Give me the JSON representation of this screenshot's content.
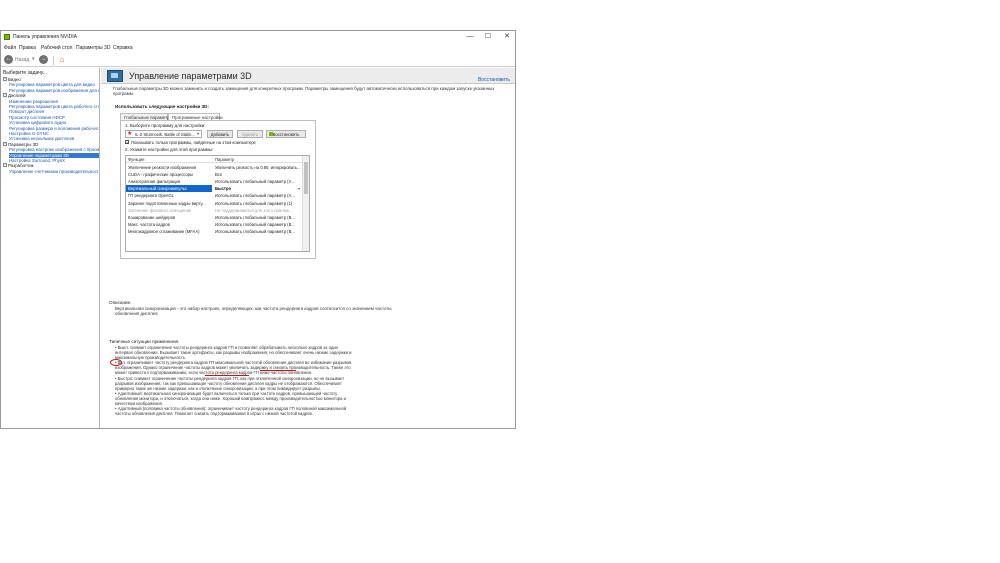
{
  "window": {
    "title": "Панель управления NVIDIA",
    "accent": "#76b900"
  },
  "menu": [
    "Файл",
    "Правка",
    "Рабочий стол",
    "Параметры 3D",
    "Справка"
  ],
  "toolbar": {
    "back_label": "Назад",
    "back_icon": "arrow-left-icon",
    "forward_icon": "arrow-right-icon",
    "home_icon": "home-icon"
  },
  "sidebar": {
    "title": "Выберите задачу...",
    "tree": [
      {
        "label": "Видео",
        "level": 0,
        "toggle": "−"
      },
      {
        "label": "Регулировка параметров цвета для видео",
        "level": 1
      },
      {
        "label": "Регулировка параметров изображения для видео",
        "level": 1
      },
      {
        "label": "Дисплей",
        "level": 0,
        "toggle": "−"
      },
      {
        "label": "Изменение разрешения",
        "level": 1
      },
      {
        "label": "Регулировка параметров цвета рабочего стола",
        "level": 1
      },
      {
        "label": "Поворот дисплея",
        "level": 1
      },
      {
        "label": "Просмотр состояния HDCP",
        "level": 1
      },
      {
        "label": "Установка цифрового аудио",
        "level": 1
      },
      {
        "label": "Регулировка размера и положения рабочего стола",
        "level": 1
      },
      {
        "label": "Настройка G-SYNC",
        "level": 1
      },
      {
        "label": "Установка нескольких дисплеев",
        "level": 1
      },
      {
        "label": "Параметры 3D",
        "level": 0,
        "toggle": "−"
      },
      {
        "label": "Регулировка настроек изображения с просмотром",
        "level": 1
      },
      {
        "label": "Управление параметрами 3D",
        "level": 1,
        "selected": true
      },
      {
        "label": "Настройка Surround, PhysX",
        "level": 1
      },
      {
        "label": "Разработчик",
        "level": 0,
        "toggle": "−"
      },
      {
        "label": "Управление счетчиками производительности",
        "level": 1
      }
    ]
  },
  "banner": {
    "title": "Управление параметрами 3D",
    "restore_link": "Восстановить"
  },
  "intro": "Глобальные параметры 3D можно заменить и создать замещения для конкретных программ. Параметры замещения будут автоматически использоваться при каждом запуске указанных программ.",
  "use_settings_label": "Использовать следующие настройки 3D:",
  "tabs": {
    "global": "Глобальные параметры",
    "program": "Программные настройки"
  },
  "program_settings": {
    "step1": "1. Выберите программу для настройки:",
    "selected_program": "IL-2 Sturmovik: Battle of Stalin...",
    "add_button": "Добавить",
    "delete_button": "Удалить",
    "restore_button": "Восстановить",
    "show_only_label": "Показывать только программы, найденные на этом компьютере",
    "step2": "2. Укажите настройки для этой программы:"
  },
  "settings_table": {
    "headers": [
      "Функция",
      "Параметр"
    ],
    "rows": [
      {
        "feature": "Увеличение резкости изображения",
        "value": "Увеличить резкость на 0.80, игнорировать..."
      },
      {
        "feature": "CUDA - графические процессоры",
        "value": "Все"
      },
      {
        "feature": "Анизотропная фильтрация",
        "value": "Использовать глобальный параметр (У..."
      },
      {
        "feature": "Вертикальный синхроимпульс",
        "value": "Быстро",
        "selected": true
      },
      {
        "feature": "ГП рендеринга OpenGL",
        "value": "Использовать глобальный параметр (А..."
      },
      {
        "feature": "Заранее подготовленные кадры вирту...",
        "value": "Использовать глобальный параметр (1)"
      },
      {
        "feature": "Затенение фонового освещения",
        "value": "Не поддерживается для этого прилож...",
        "disabled": true
      },
      {
        "feature": "Кэширование шейдеров",
        "value": "Использовать глобальный параметр (В..."
      },
      {
        "feature": "Макс. частота кадров",
        "value": "Использовать глобальный параметр (В..."
      },
      {
        "feature": "Многокадровое сглаживание (MFAA)",
        "value": "Использовать глобальный параметр (В..."
      }
    ]
  },
  "description": {
    "label": "Описание.",
    "text": "Вертикальная синхронизация - это набор настроек, определяющих, как частота рендеринга кадров соотносится со значением частоты обновления дисплея."
  },
  "usage": {
    "label": "Типичные ситуации применения.",
    "items": [
      "• Выкл. снимает ограничение частоты рендеринга кадров ГП и позволяет обрабатывать несколько кадров за один интервал обновления. Вызывает такие артефакты, как разрывы изображения, но обеспечивает очень низкие задержки и максимальную производительность.",
      "• Вкл. ограничивает частоту рендеринга кадров ГП максимальной частотой обновления дисплея во избежание разрывов изображения. Однако ограничение частоты кадров может увеличить задержку и снизить производительность. Также это может привести к подтормаживанию, если частота рендеринга кадров ГП ниже частоты обновления.",
      "• Быстро: снимает ограничение частоты рендеринга кадров ГП, как при отключенной синхронизации, но не вызывает разрывов изображения, так как превышающие частоту обновления дисплея кадры не отображаются. Обеспечивает примерно такие же низкие задержки, как и отключение синхронизации, а при этом ликвидирует разрывы.",
      "• Адаптивный: вертикальная синхронизация будет включаться только при частоте кадров, превышающей частоту обновления монитора, и отключаться, когда она ниже. Хороший компромисс между производительностью монитора и качеством изображения.",
      "• Адаптивный (половина частоты обновления): ограничивает частоту рендеринга кадров ГП половиной максимальной частоты обновления дисплея. Помогает снизить подтормаживание в играх с низкой частотой кадров."
    ]
  },
  "annotation_color": "#d01010"
}
